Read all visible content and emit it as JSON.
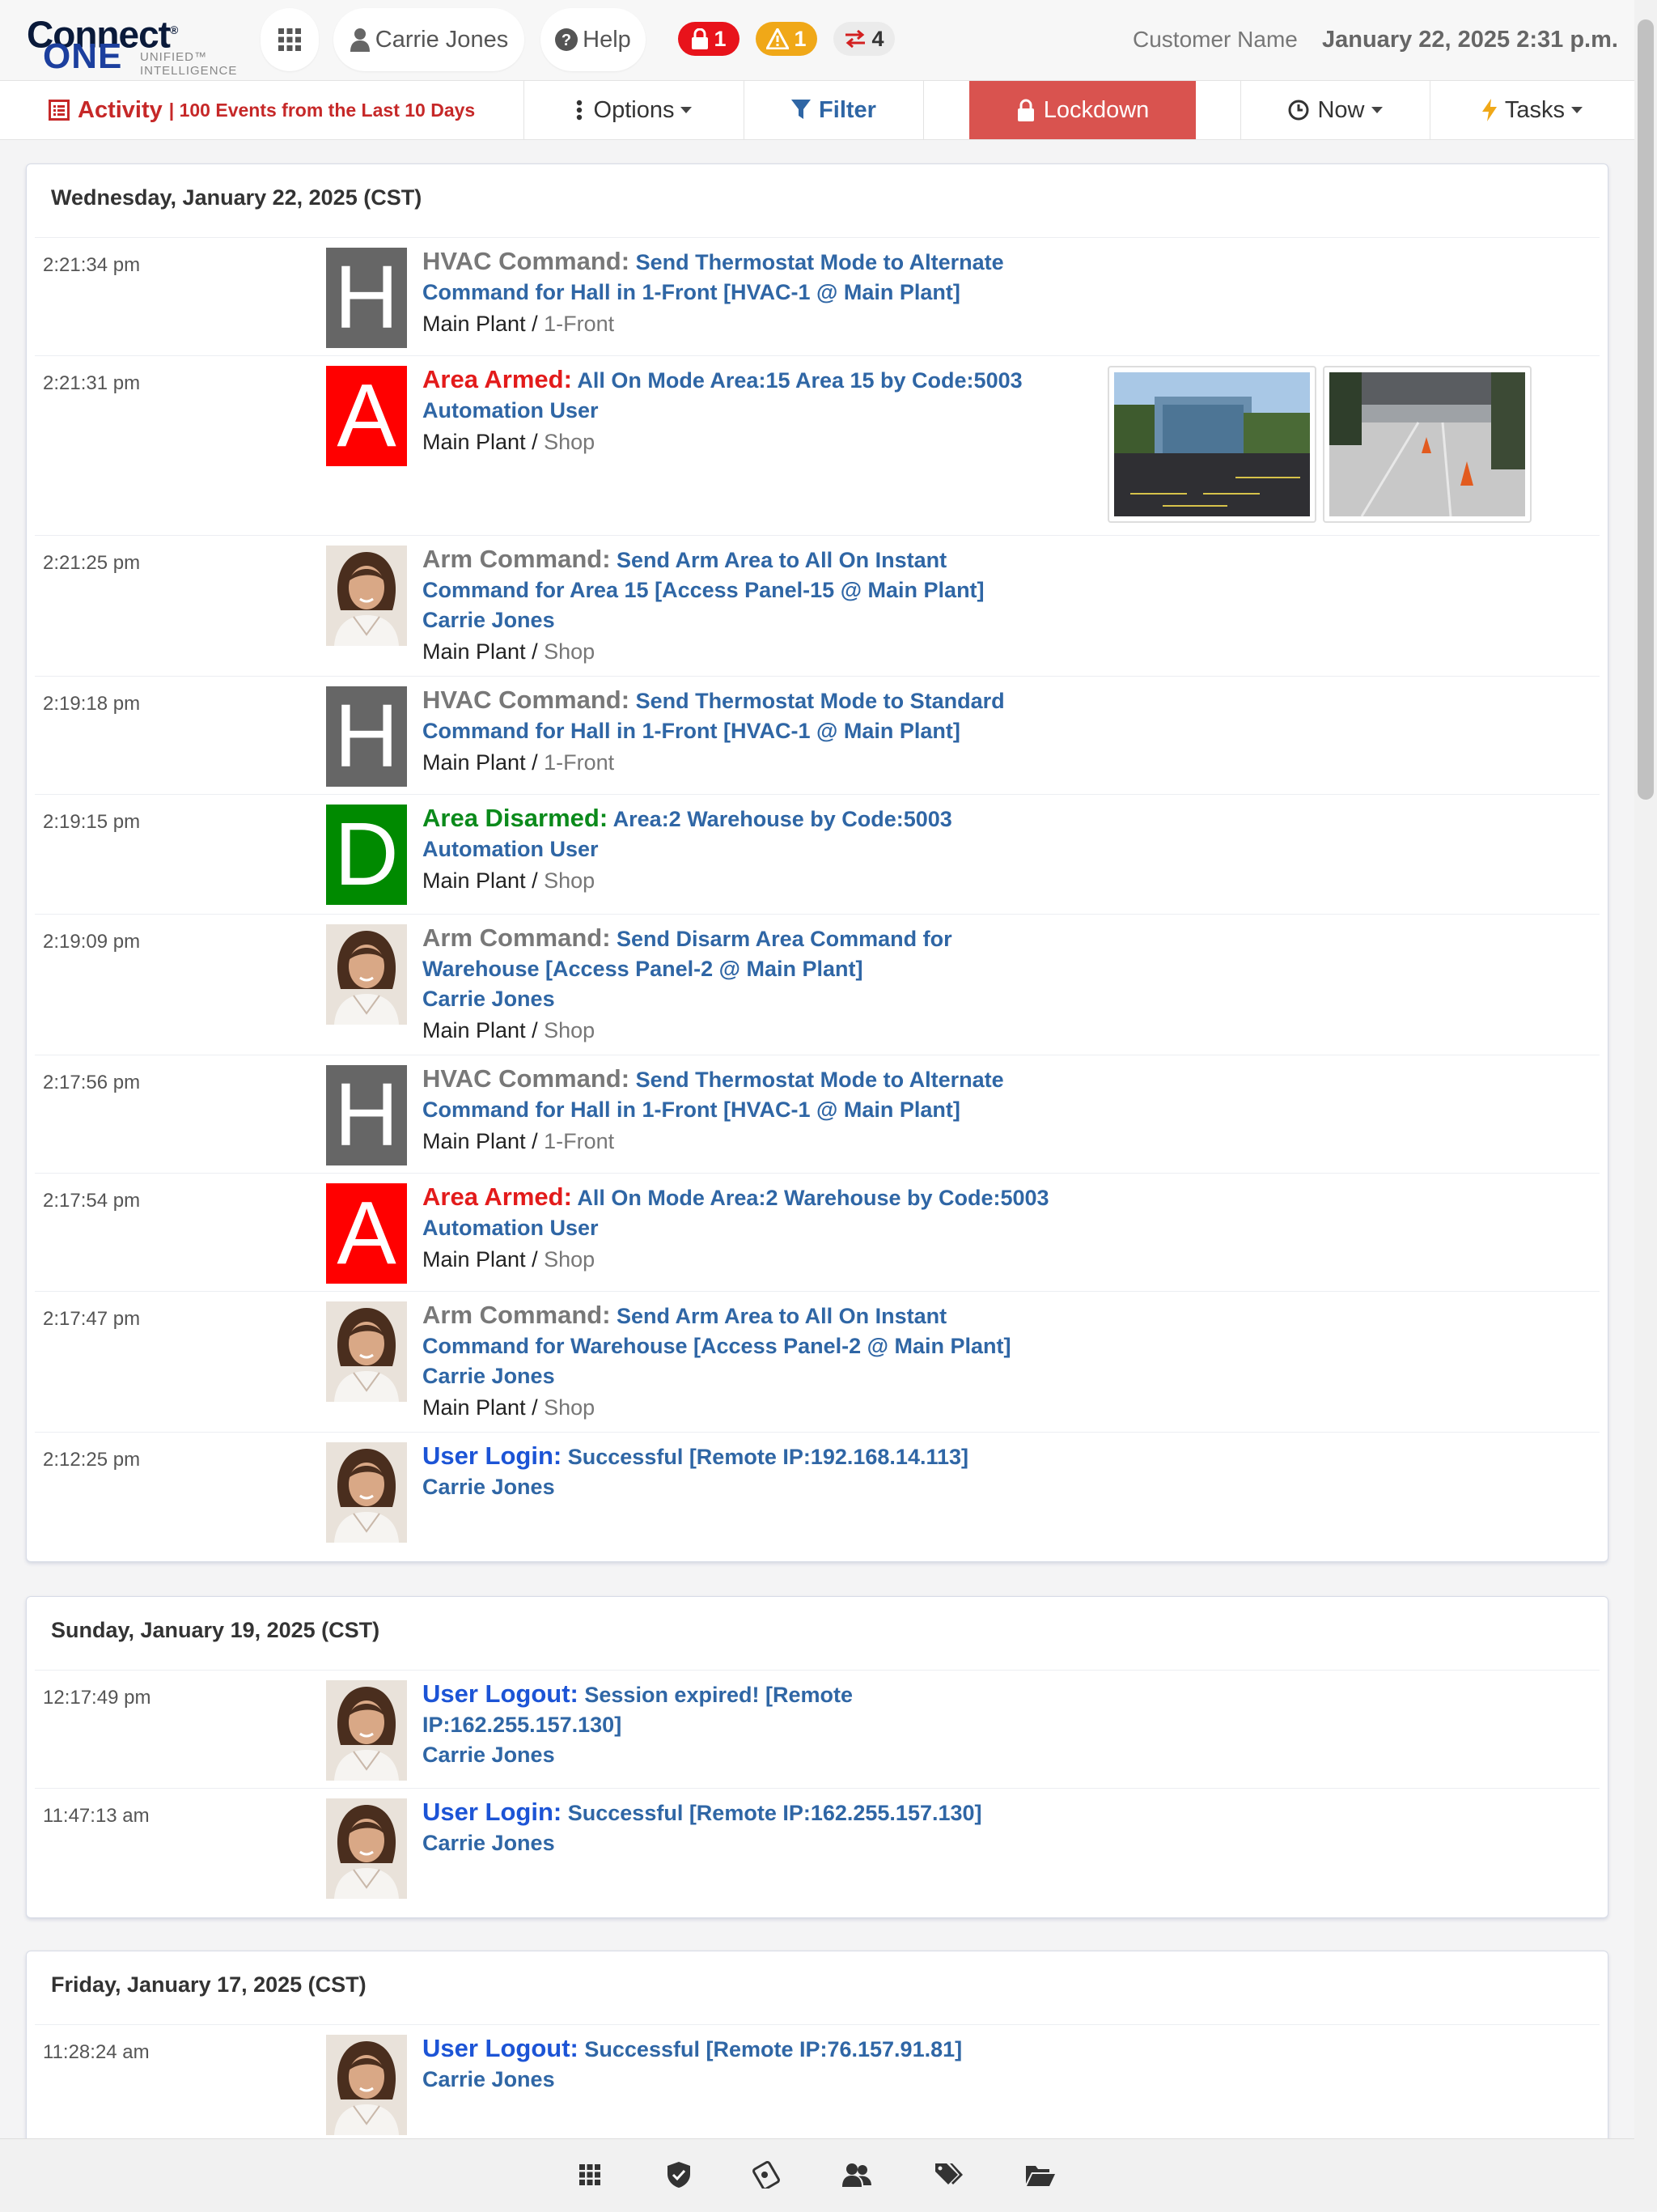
{
  "header": {
    "logo": {
      "word1": "Connect",
      "word2": "ONE",
      "tagline1": "UNIFIED™",
      "tagline2": "INTELLIGENCE"
    },
    "apps_icon": "grid-icon",
    "user_name": "Carrie Jones",
    "help_label": "Help",
    "badges": [
      {
        "icon": "lock-icon",
        "count": "1",
        "color": "#e8131b"
      },
      {
        "icon": "warning-icon",
        "count": "1",
        "color": "#f0a818"
      },
      {
        "icon": "transfer-icon",
        "count": "4",
        "color": "#ebebeb"
      }
    ],
    "customer_name": "Customer Name",
    "datetime": "January 22, 2025 2:31 p.m."
  },
  "toolbar": {
    "activity_label": "Activity",
    "activity_sub": "| 100 Events from the Last 10 Days",
    "options_label": "Options",
    "filter_label": "Filter",
    "lockdown_label": "Lockdown",
    "now_label": "Now",
    "tasks_label": "Tasks"
  },
  "days": [
    {
      "title": "Wednesday, January 22, 2025 (CST)",
      "events": [
        {
          "time": "2:21:34 pm",
          "icon": "H",
          "type": "HVAC Command:",
          "lines": [
            "Send Thermostat Mode to Alternate",
            "Command for Hall in 1-Front [HVAC-1 @ Main Plant]"
          ],
          "user": "",
          "site": "Main Plant",
          "zone": "1-Front"
        },
        {
          "time": "2:21:31 pm",
          "icon": "A",
          "type": "Area Armed:",
          "lines": [
            "All On Mode Area:15 Area 15 by Code:5003"
          ],
          "user": "Automation User",
          "site": "Main Plant",
          "zone": "Shop"
        },
        {
          "time": "2:21:25 pm",
          "icon": "avatar",
          "type": "Arm Command:",
          "lines": [
            "Send Arm Area to All On Instant",
            "Command for Area 15 [Access Panel-15 @ Main Plant]"
          ],
          "user": "Carrie Jones",
          "site": "Main Plant",
          "zone": "Shop"
        },
        {
          "time": "2:19:18 pm",
          "icon": "H",
          "type": "HVAC Command:",
          "lines": [
            "Send Thermostat Mode to Standard",
            "Command for Hall in 1-Front [HVAC-1 @ Main Plant]"
          ],
          "user": "",
          "site": "Main Plant",
          "zone": "1-Front"
        },
        {
          "time": "2:19:15 pm",
          "icon": "D",
          "type": "Area Disarmed:",
          "lines": [
            "Area:2 Warehouse by Code:5003"
          ],
          "user": "Automation User",
          "site": "Main Plant",
          "zone": "Shop"
        },
        {
          "time": "2:19:09 pm",
          "icon": "avatar",
          "type": "Arm Command:",
          "lines": [
            "Send Disarm Area Command for",
            "Warehouse [Access Panel-2 @ Main Plant]"
          ],
          "user": "Carrie Jones",
          "site": "Main Plant",
          "zone": "Shop"
        },
        {
          "time": "2:17:56 pm",
          "icon": "H",
          "type": "HVAC Command:",
          "lines": [
            "Send Thermostat Mode to Alternate",
            "Command for Hall in 1-Front [HVAC-1 @ Main Plant]"
          ],
          "user": "",
          "site": "Main Plant",
          "zone": "1-Front"
        },
        {
          "time": "2:17:54 pm",
          "icon": "A",
          "type": "Area Armed:",
          "lines": [
            "All On Mode Area:2 Warehouse by Code:5003"
          ],
          "user": "Automation User",
          "site": "Main Plant",
          "zone": "Shop"
        },
        {
          "time": "2:17:47 pm",
          "icon": "avatar",
          "type": "Arm Command:",
          "lines": [
            "Send Arm Area to All On Instant",
            "Command for Warehouse [Access Panel-2 @ Main Plant]"
          ],
          "user": "Carrie Jones",
          "site": "Main Plant",
          "zone": "Shop"
        },
        {
          "time": "2:12:25 pm",
          "icon": "avatar",
          "type": "User Login:",
          "lines": [
            "Successful [Remote IP:192.168.14.113]"
          ],
          "user": "Carrie Jones",
          "site": "",
          "zone": ""
        }
      ]
    },
    {
      "title": "Sunday, January 19, 2025 (CST)",
      "events": [
        {
          "time": "12:17:49 pm",
          "icon": "avatar",
          "type": "User Logout:",
          "lines": [
            "Session expired! [Remote",
            "IP:162.255.157.130]"
          ],
          "user": "Carrie Jones",
          "site": "",
          "zone": ""
        },
        {
          "time": "11:47:13 am",
          "icon": "avatar",
          "type": "User Login:",
          "lines": [
            "Successful [Remote IP:162.255.157.130]"
          ],
          "user": "Carrie Jones",
          "site": "",
          "zone": ""
        }
      ]
    },
    {
      "title": "Friday, January 17, 2025 (CST)",
      "events": [
        {
          "time": "11:28:24 am",
          "icon": "avatar",
          "type": "User Logout:",
          "lines": [
            "Successful [Remote IP:76.157.91.81]"
          ],
          "user": "Carrie Jones",
          "site": "",
          "zone": ""
        }
      ]
    }
  ],
  "icon_colors": {
    "H": "#666666",
    "A": "#ff0000",
    "D": "#008a00"
  },
  "type_colors": {
    "HVAC Command:": "#787878",
    "Arm Command:": "#787878",
    "Area Armed:": "#e31b1b",
    "Area Disarmed:": "#0b8a1b",
    "User Login:": "#1c54d6",
    "User Logout:": "#1c54d6"
  },
  "bottom_nav": [
    "grid-icon",
    "shield-icon",
    "badge-icon",
    "users-icon",
    "tags-icon",
    "folder-icon"
  ]
}
